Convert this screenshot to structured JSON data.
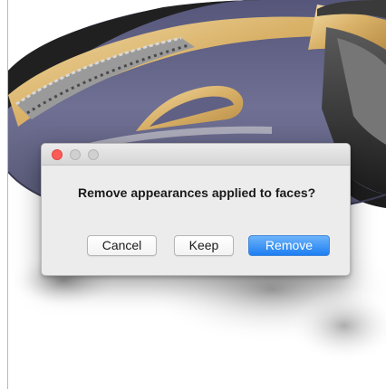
{
  "window": {
    "controls": [
      "close-icon",
      "minimize-icon",
      "zoom-icon"
    ]
  },
  "dialog": {
    "message": "Remove appearances applied to faces?",
    "buttons": {
      "cancel": "Cancel",
      "keep": "Keep",
      "remove": "Remove"
    }
  },
  "colors": {
    "accent": "#1d7ef2",
    "close": "#fc5b57",
    "dialog_bg": "#ececec",
    "model_body": "#6b6c8e",
    "model_trim": "#e2c07a"
  }
}
